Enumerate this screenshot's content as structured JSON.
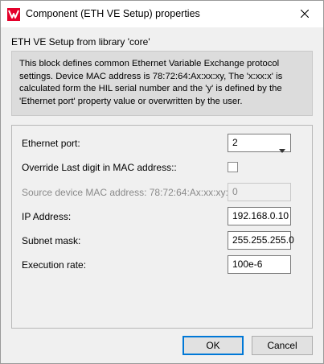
{
  "window": {
    "title": "Component (ETH VE Setup) properties",
    "brand_color": "#e4002b"
  },
  "header": {
    "subtitle": "ETH VE Setup from library 'core'",
    "description": "This block defines common Ethernet Variable Exchange protocol settings. Device MAC address is 78:72:64:Ax:xx:xy, The 'x:xx:x' is calculated form the HIL serial number and the 'y' is defined by the 'Ethernet port' property value or overwritten by the user."
  },
  "properties": {
    "ethernet_port": {
      "label": "Ethernet port:",
      "value": "2"
    },
    "override_last_digit": {
      "label": "Override Last digit in MAC address::",
      "checked": false
    },
    "source_mac": {
      "label": "Source device MAC address: 78:72:64:Ax:xx:xy:",
      "value": "0"
    },
    "ip_address": {
      "label": "IP Address:",
      "value": "192.168.0.10"
    },
    "subnet_mask": {
      "label": "Subnet mask:",
      "value": "255.255.255.0"
    },
    "execution_rate": {
      "label": "Execution rate:",
      "value": "100e-6"
    }
  },
  "buttons": {
    "ok": "OK",
    "cancel": "Cancel"
  }
}
